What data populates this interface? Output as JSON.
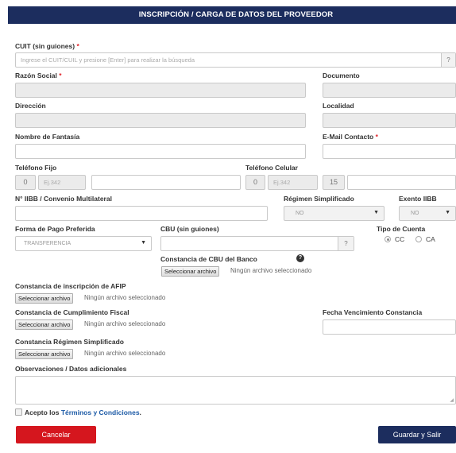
{
  "header": {
    "title": "INSCRIPCIÓN / CARGA DE DATOS DEL PROVEEDOR"
  },
  "cuit": {
    "label": "CUIT (sin guiones)",
    "required": "*",
    "placeholder": "Ingrese el CUIT/CUIL y presione [Enter] para realizar la búsqueda",
    "help": "?"
  },
  "razon_social": {
    "label": "Razón Social",
    "required": "*"
  },
  "documento": {
    "label": "Documento"
  },
  "direccion": {
    "label": "Dirección"
  },
  "localidad": {
    "label": "Localidad"
  },
  "nombre_fantasia": {
    "label": "Nombre de Fantasía"
  },
  "email": {
    "label": "E-Mail Contacto",
    "required": "*"
  },
  "telefono_fijo": {
    "label": "Teléfono Fijo",
    "prefix": "0",
    "area_placeholder": "Ej.342"
  },
  "telefono_celular": {
    "label": "Teléfono Celular",
    "prefix": "0",
    "area_placeholder": "Ej.342",
    "mid": "15"
  },
  "iibb": {
    "label": "N° IIBB / Convenio Multilateral"
  },
  "regimen_simplificado": {
    "label": "Régimen Simplificado",
    "value": "NO"
  },
  "exento_iibb": {
    "label": "Exento IIBB",
    "value": "NO"
  },
  "forma_pago": {
    "label": "Forma de Pago Preferida",
    "value": "TRANSFERENCIA"
  },
  "cbu": {
    "label": "CBU (sin guiones)",
    "help": "?"
  },
  "tipo_cuenta": {
    "label": "Tipo de Cuenta",
    "options": [
      "CC",
      "CA"
    ],
    "selected": "CC"
  },
  "constancia_cbu": {
    "label": "Constancia de CBU del Banco",
    "info_icon": "question-circle-icon",
    "button": "Seleccionar archivo",
    "status": "Ningún archivo seleccionado"
  },
  "constancia_afip": {
    "label": "Constancia de inscripción de AFIP",
    "button": "Seleccionar archivo",
    "status": "Ningún archivo seleccionado"
  },
  "constancia_fiscal": {
    "label": "Constancia de Cumplimiento Fiscal",
    "button": "Seleccionar archivo",
    "status": "Ningún archivo seleccionado"
  },
  "fecha_vencimiento": {
    "label": "Fecha Vencimiento Constancia"
  },
  "constancia_regimen": {
    "label": "Constancia Régimen Simplificado",
    "button": "Seleccionar archivo",
    "status": "Ningún archivo seleccionado"
  },
  "observaciones": {
    "label": "Observaciones / Datos adicionales"
  },
  "terminos": {
    "prefix": "Acepto los",
    "link": "Términos y Condiciones",
    "suffix": "."
  },
  "actions": {
    "cancel": "Cancelar",
    "save": "Guardar y Salir"
  },
  "colors": {
    "header": "#1c2d5e",
    "cancel": "#d5161e",
    "required": "#e0242a",
    "link": "#1c5aa6"
  }
}
